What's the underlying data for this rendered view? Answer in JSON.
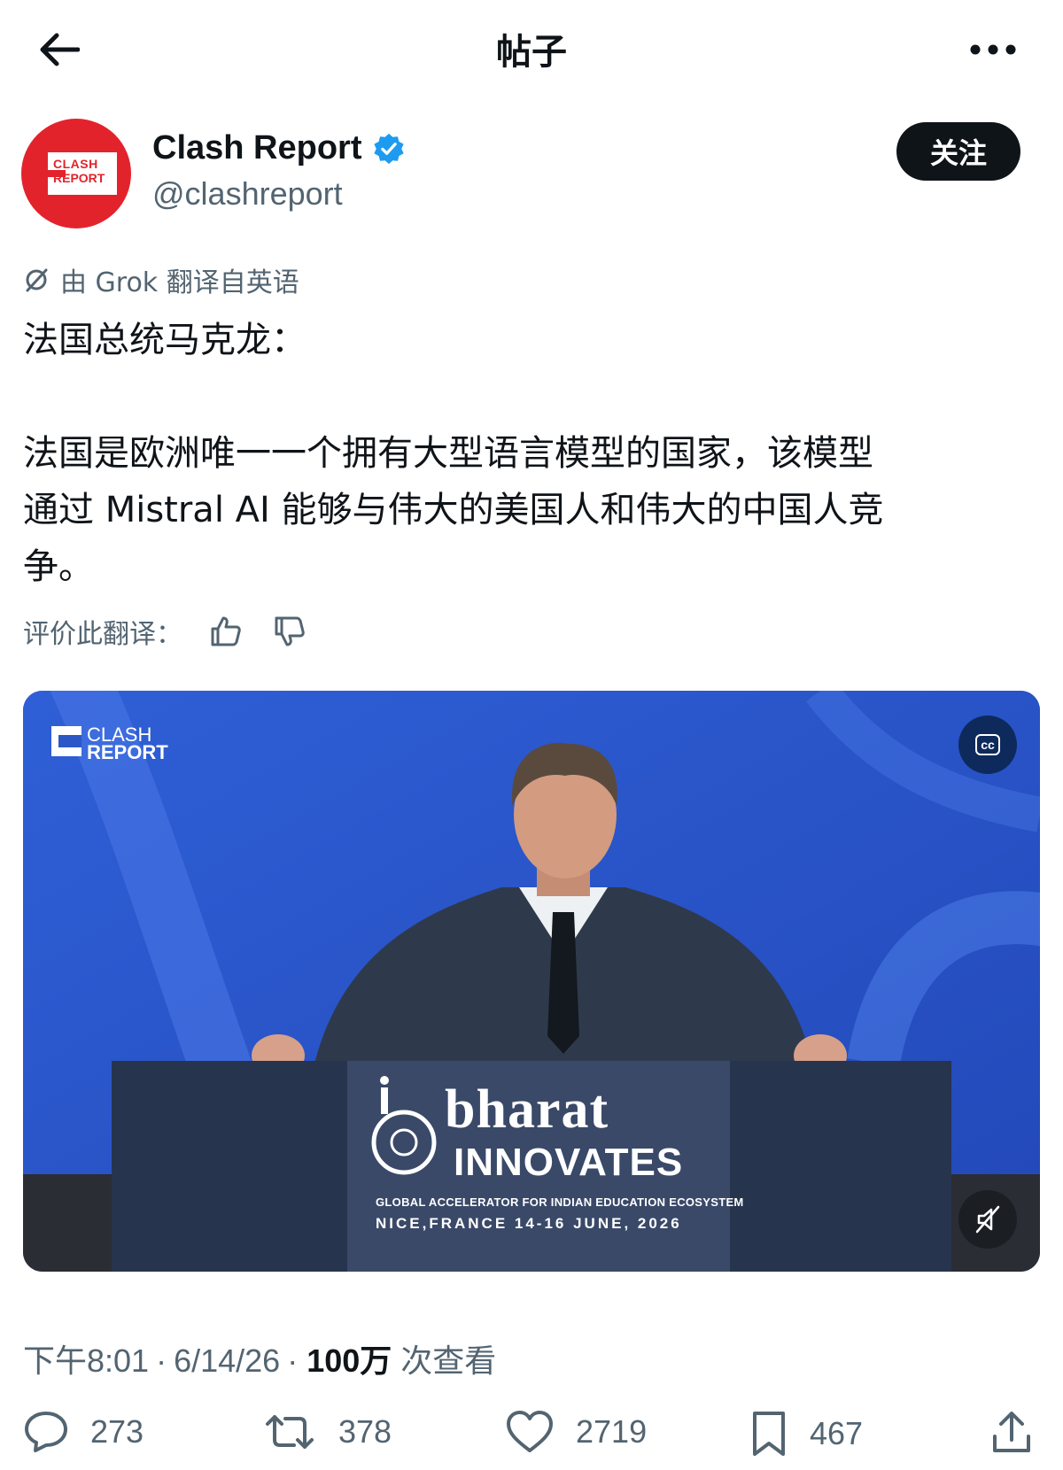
{
  "header": {
    "title": "帖子"
  },
  "author": {
    "avatar_text_line1": "CLASH",
    "avatar_text_line2": "REPORT",
    "name": "Clash Report",
    "handle": "@clashreport",
    "follow_label": "关注"
  },
  "post": {
    "translation_note": "由 Grok 翻译自英语",
    "text": "法国总统马克龙：\n\n法国是欧洲唯一一个拥有大型语言模型的国家，该模型\n通过 Mistral AI 能够与伟大的美国人和伟大的中国人竞\n争。",
    "rate_label": "评价此翻译："
  },
  "media": {
    "watermark_line1": "CLASH",
    "watermark_line2": "REPORT",
    "cc_label": "cc",
    "podium_brand": "bharat",
    "podium_title": "INNOVATES",
    "podium_subtitle": "GLOBAL ACCELERATOR FOR INDIAN EDUCATION ECOSYSTEM",
    "podium_event": "NICE,FRANCE 14-16 JUNE, 2026"
  },
  "meta": {
    "time": "下午8:01",
    "date": "6/14/26",
    "separator": "·",
    "views": "100万",
    "views_label": "次查看"
  },
  "actions": {
    "replies": "273",
    "reposts": "378",
    "likes": "2719",
    "bookmarks": "467"
  },
  "colors": {
    "text_primary": "#0f1419",
    "text_secondary": "#536471",
    "verified_blue": "#1d9bf0",
    "brand_red": "#e3232c"
  }
}
